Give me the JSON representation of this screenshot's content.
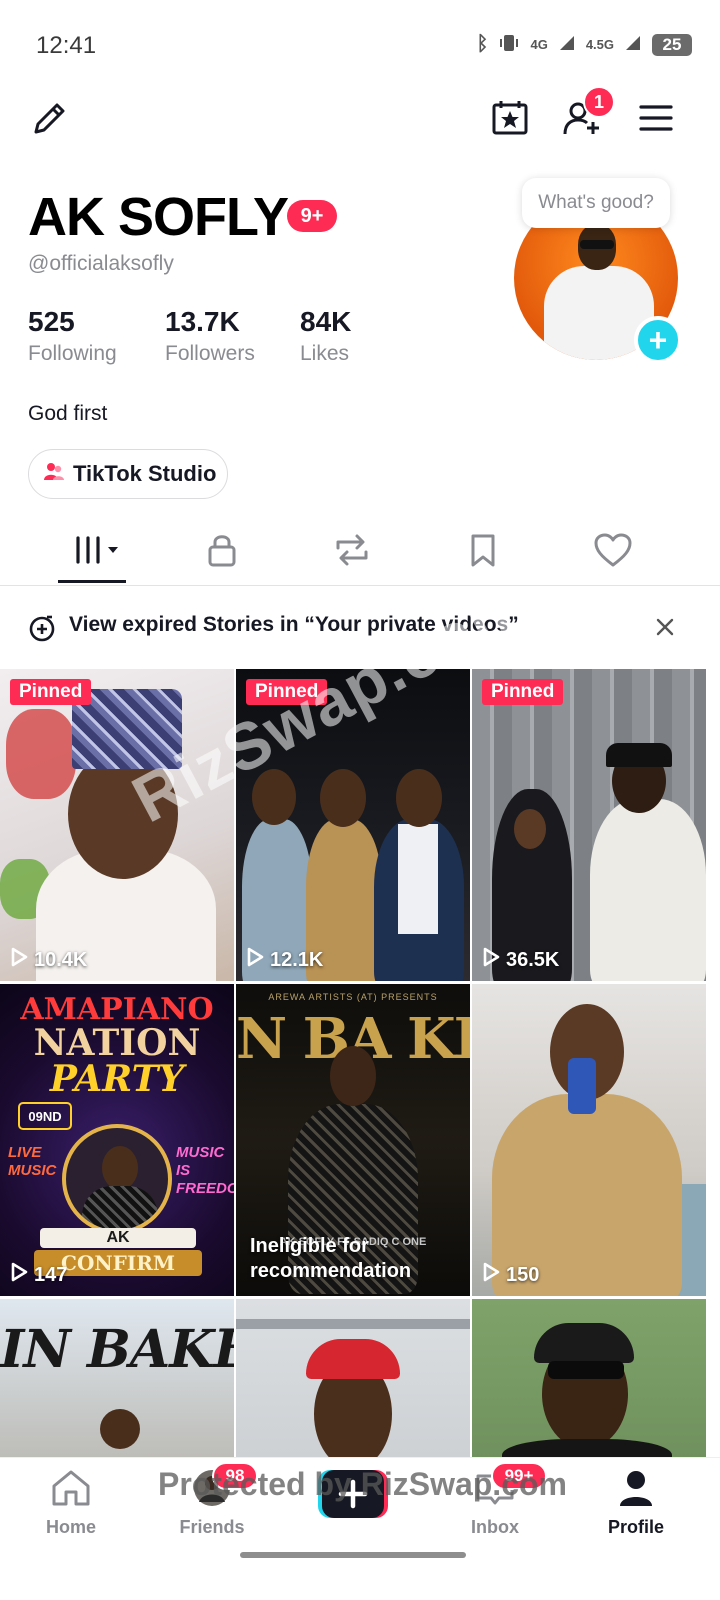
{
  "status_bar": {
    "time": "12:41",
    "network_1": "4G",
    "network_2": "4.5G",
    "battery": "25"
  },
  "top_bar": {
    "follow_requests_badge": "1"
  },
  "profile": {
    "display_name": "AK SOFLY",
    "name_badge": "9+",
    "username": "@officialaksofly",
    "stats": [
      {
        "value": "525",
        "label": "Following"
      },
      {
        "value": "13.7K",
        "label": "Followers"
      },
      {
        "value": "84K",
        "label": "Likes"
      }
    ],
    "bio": "God first",
    "studio_button": "TikTok Studio",
    "thought_bubble": "What's good?"
  },
  "banner": {
    "text": "View expired Stories in “Your private videos”"
  },
  "videos": [
    {
      "pinned": "Pinned",
      "views": "10.4K"
    },
    {
      "pinned": "Pinned",
      "views": "12.1K"
    },
    {
      "pinned": "Pinned",
      "views": "36.5K"
    },
    {
      "views": "147",
      "poster_title_1": "AMAPIANO",
      "poster_title_2": "NATION",
      "poster_title_3": "PARTY",
      "poster_date": "09ND",
      "poster_name": "AK",
      "poster_confirm": "CONFIRM",
      "poster_left": "LIVE MUSIC",
      "poster_right": "MUSIC IS FREEDOM"
    },
    {
      "notice": "Ineligible for recommendation",
      "poster_header": "AREWA ARTISTS (AT) PRESENTS",
      "poster_title": "N BA KE BA",
      "poster_credit": "AK SOFLY  FT  SADIQ C ONE"
    },
    {
      "views": "150"
    },
    {
      "poster_title": "IN BAKEBA"
    },
    {},
    {}
  ],
  "overlays": {
    "watermark": "RizSwap.com",
    "protected": "Protected by RizSwap.com"
  },
  "bottom_nav": {
    "home": "Home",
    "friends": "Friends",
    "friends_badge": "98",
    "inbox": "Inbox",
    "inbox_badge": "99+",
    "profile": "Profile"
  },
  "colors": {
    "accent_red": "#fe2c55",
    "accent_cyan": "#20d5ec",
    "text_primary": "#161823",
    "text_secondary": "#8a8b91"
  }
}
